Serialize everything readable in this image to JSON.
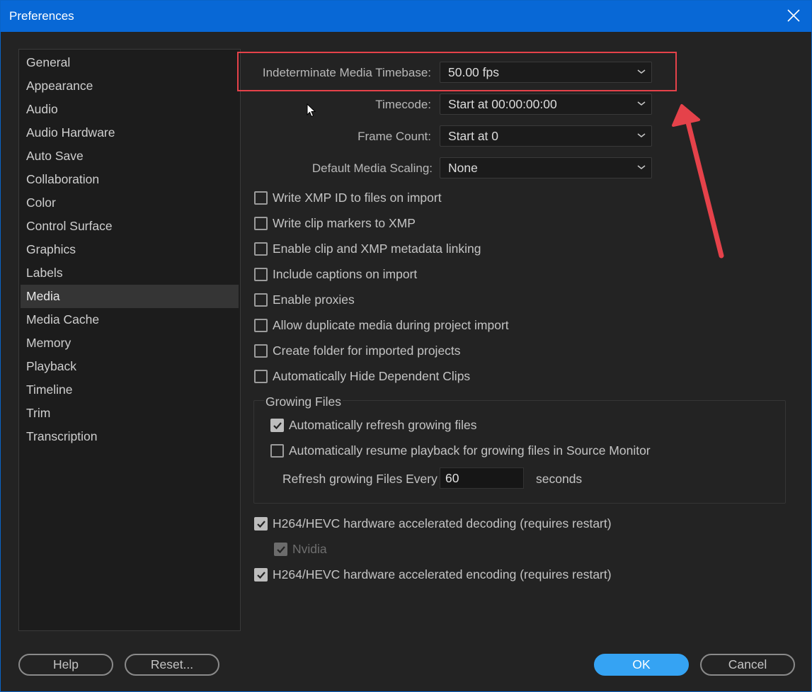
{
  "window": {
    "title": "Preferences",
    "close_icon": "close-icon"
  },
  "sidebar": {
    "items": [
      {
        "label": "General"
      },
      {
        "label": "Appearance"
      },
      {
        "label": "Audio"
      },
      {
        "label": "Audio Hardware"
      },
      {
        "label": "Auto Save"
      },
      {
        "label": "Collaboration"
      },
      {
        "label": "Color"
      },
      {
        "label": "Control Surface"
      },
      {
        "label": "Graphics"
      },
      {
        "label": "Labels"
      },
      {
        "label": "Media",
        "selected": true
      },
      {
        "label": "Media Cache"
      },
      {
        "label": "Memory"
      },
      {
        "label": "Playback"
      },
      {
        "label": "Timeline"
      },
      {
        "label": "Trim"
      },
      {
        "label": "Transcription"
      }
    ]
  },
  "media": {
    "timebase": {
      "label": "Indeterminate Media Timebase:",
      "value": "50.00 fps"
    },
    "timecode": {
      "label": "Timecode:",
      "value": "Start at 00:00:00:00"
    },
    "frame_count": {
      "label": "Frame Count:",
      "value": "Start at 0"
    },
    "scaling": {
      "label": "Default Media Scaling:",
      "value": "None"
    },
    "checkboxes": [
      {
        "label": "Write XMP ID to files on import",
        "checked": false
      },
      {
        "label": "Write clip markers to XMP",
        "checked": false
      },
      {
        "label": "Enable clip and XMP metadata linking",
        "checked": false
      },
      {
        "label": "Include captions on import",
        "checked": false
      },
      {
        "label": "Enable proxies",
        "checked": false
      },
      {
        "label": "Allow duplicate media during project import",
        "checked": false
      },
      {
        "label": "Create folder for imported projects",
        "checked": false
      },
      {
        "label": "Automatically Hide Dependent Clips",
        "checked": false
      }
    ],
    "growing_files": {
      "title": "Growing Files",
      "auto_refresh": {
        "label": "Automatically refresh growing files",
        "checked": true
      },
      "auto_resume": {
        "label": "Automatically resume playback for growing files in Source Monitor",
        "checked": false
      },
      "refresh_label": "Refresh growing Files Every",
      "refresh_value": "60",
      "refresh_unit": "seconds"
    },
    "hw_decoding": {
      "label": "H264/HEVC hardware accelerated decoding (requires restart)",
      "checked": true
    },
    "nvidia": {
      "label": "Nvidia",
      "checked": true,
      "disabled": true
    },
    "hw_encoding": {
      "label": "H264/HEVC hardware accelerated encoding (requires restart)",
      "checked": true
    }
  },
  "buttons": {
    "help": "Help",
    "reset": "Reset...",
    "ok": "OK",
    "cancel": "Cancel"
  },
  "colors": {
    "titlebar": "#0868d6",
    "accent": "#35a3f3",
    "annotation": "#e5424a"
  }
}
